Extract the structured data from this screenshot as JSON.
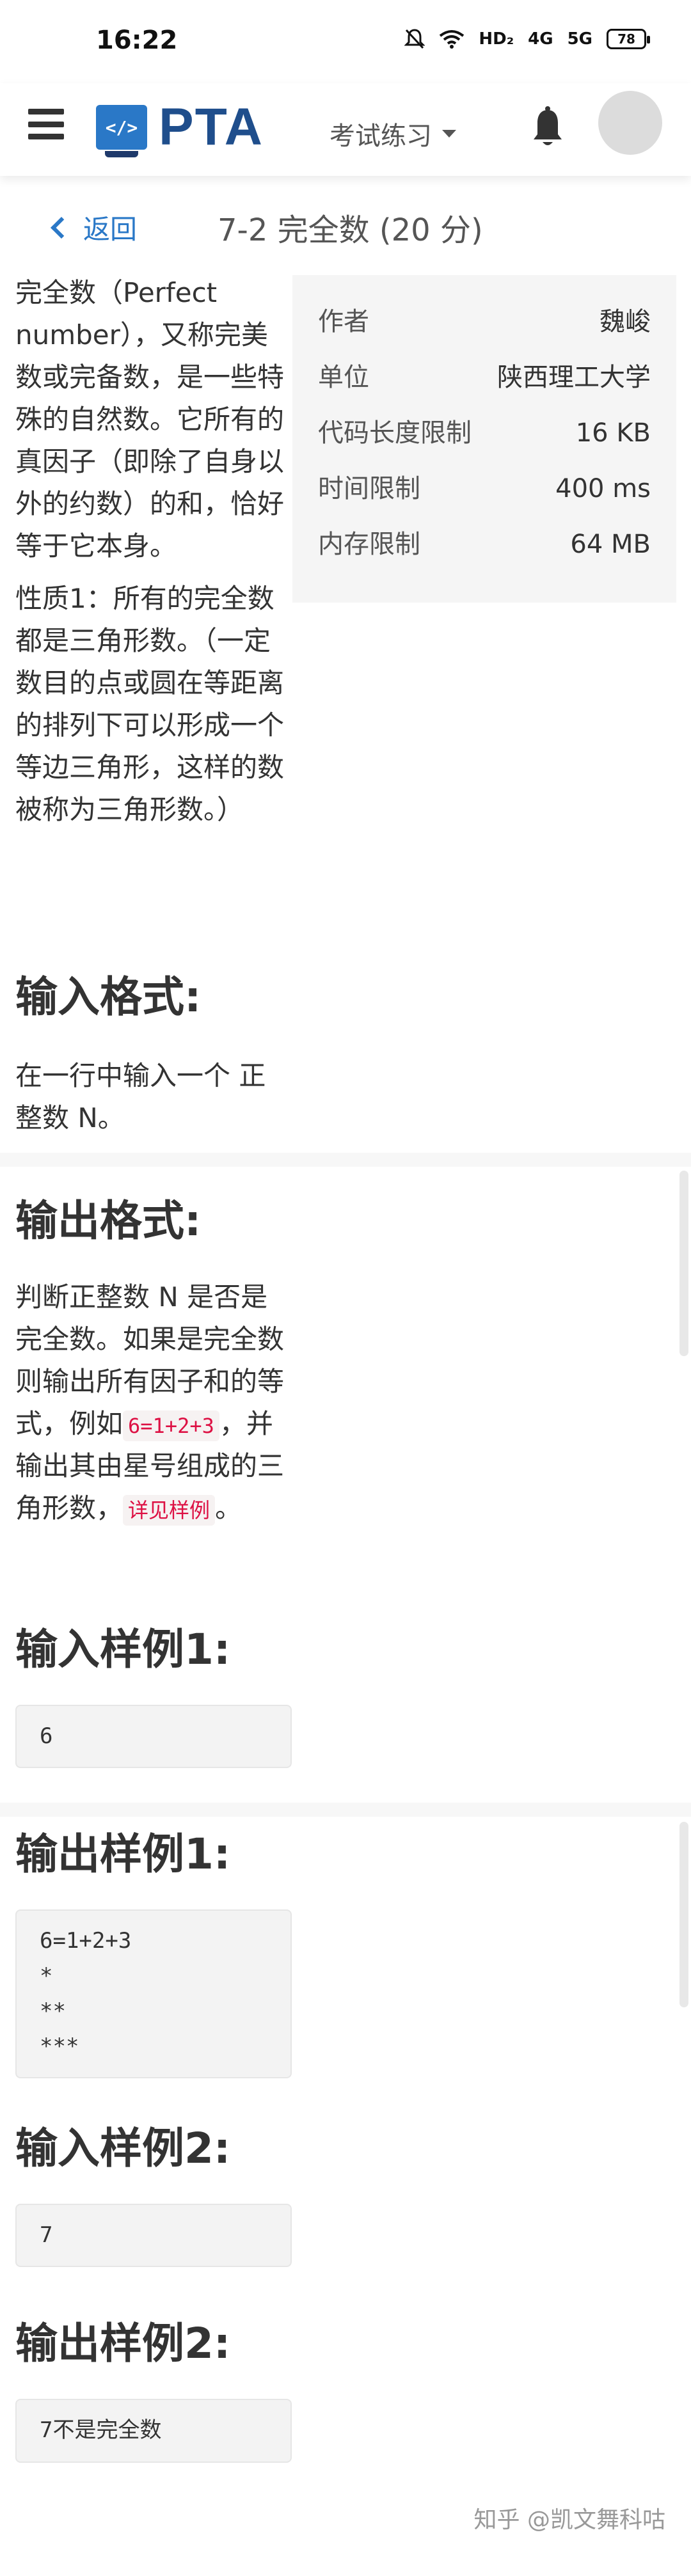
{
  "status_bar": {
    "time": "16:22",
    "hd_label": "HD₂",
    "signal1": "4G",
    "signal2": "5G",
    "battery": "78",
    "icons": [
      "mute-bell-icon",
      "wifi-icon",
      "signal-icon",
      "battery-icon"
    ]
  },
  "header": {
    "logo_text": "PTA",
    "menu_label": "考试练习",
    "icons": [
      "hamburger-icon",
      "bell-icon",
      "avatar"
    ]
  },
  "title_bar": {
    "back_label": "返回",
    "title": "7-2 完全数 (20 分)"
  },
  "problem": {
    "intro": "完全数（Perfect number），又称完美数或完备数，是一些特殊的自然数。它所有的真因子（即除了自身以外的约数）的和，恰好等于它本身。",
    "property": "性质1：所有的完全数都是三角形数。（一定数目的点或圆在等距离的排列下可以形成一个等边三角形，这样的数被称为三角形数。）",
    "input_heading": "输入格式:",
    "input_text": "在一行中输入一个 正整数 N。",
    "output_heading": "输出格式:",
    "output_text_1": "判断正整数 N 是否是完全数。如果是完全数则输出所有因子和的等式，例如",
    "output_code_1": "6=1+2+3",
    "output_text_2": "，并输出其由星号组成的三角形数，",
    "output_code_2": "详见样例",
    "output_text_3": "。",
    "sample_in_1_heading": "输入样例1:",
    "sample_in_1": "6",
    "sample_out_1_heading": "输出样例1:",
    "sample_out_1": "6=1+2+3\n*\n**\n***",
    "sample_in_2_heading": "输入样例2:",
    "sample_in_2": "7",
    "sample_out_2_heading": "输出样例2:",
    "sample_out_2": "7不是完全数"
  },
  "info": {
    "rows": [
      {
        "key": "作者",
        "value": "魏峻"
      },
      {
        "key": "单位",
        "value": "陕西理工大学"
      },
      {
        "key": "代码长度限制",
        "value": "16 KB"
      },
      {
        "key": "时间限制",
        "value": "400 ms"
      },
      {
        "key": "内存限制",
        "value": "64 MB"
      }
    ]
  },
  "footer": {
    "watermark": "知乎 @凯文舞科咕"
  }
}
